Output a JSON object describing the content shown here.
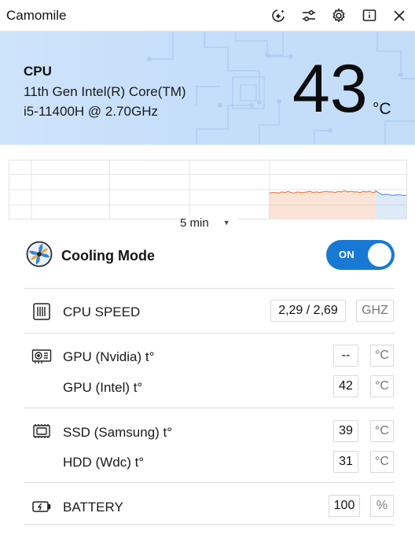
{
  "app": {
    "title": "Camomile"
  },
  "toolbar": {
    "icons": [
      "ai-sparkle-icon",
      "sliders-icon",
      "gear-icon",
      "info-icon",
      "close-icon"
    ]
  },
  "cpu": {
    "label": "CPU",
    "name_line1": "11th Gen Intel(R) Core(TM)",
    "name_line2": "i5-11400H @ 2.70GHz",
    "temperature": "43",
    "unit": "°C"
  },
  "chart_data": {
    "type": "area",
    "range_label": "5 min",
    "series": [
      {
        "color": "#e8824a",
        "values": [
          44,
          45,
          45,
          44,
          46,
          45,
          47,
          45,
          44,
          46,
          45,
          45,
          46,
          47,
          45,
          46,
          45,
          46,
          47,
          46,
          46,
          45,
          47,
          46,
          48,
          46,
          47,
          46,
          46,
          45,
          47,
          46,
          47,
          45,
          46
        ]
      },
      {
        "color": "#6a9ee0",
        "values": [
          48,
          44,
          41,
          42,
          41,
          40,
          41,
          41,
          40,
          40
        ]
      }
    ]
  },
  "cooling": {
    "label": "Cooling Mode",
    "toggle_text": "ON",
    "enabled": true
  },
  "metrics": {
    "cpu_speed": {
      "label": "CPU SPEED",
      "value": "2,29 / 2,69",
      "unit": "GHZ"
    },
    "gpu_nvidia": {
      "label": "GPU (Nvidia) t°",
      "value": "--",
      "unit": "°C"
    },
    "gpu_intel": {
      "label": "GPU (Intel) t°",
      "value": "42",
      "unit": "°C"
    },
    "ssd": {
      "label": "SSD (Samsung) t°",
      "value": "39",
      "unit": "°C"
    },
    "hdd": {
      "label": "HDD (Wdc) t°",
      "value": "31",
      "unit": "°C"
    },
    "battery": {
      "label": "BATTERY",
      "value": "100",
      "unit": "%"
    }
  },
  "colors": {
    "accent": "#1779d4",
    "banner": "#c5defa",
    "chart_orange": "#e8824a",
    "chart_blue": "#6a9ee0"
  }
}
